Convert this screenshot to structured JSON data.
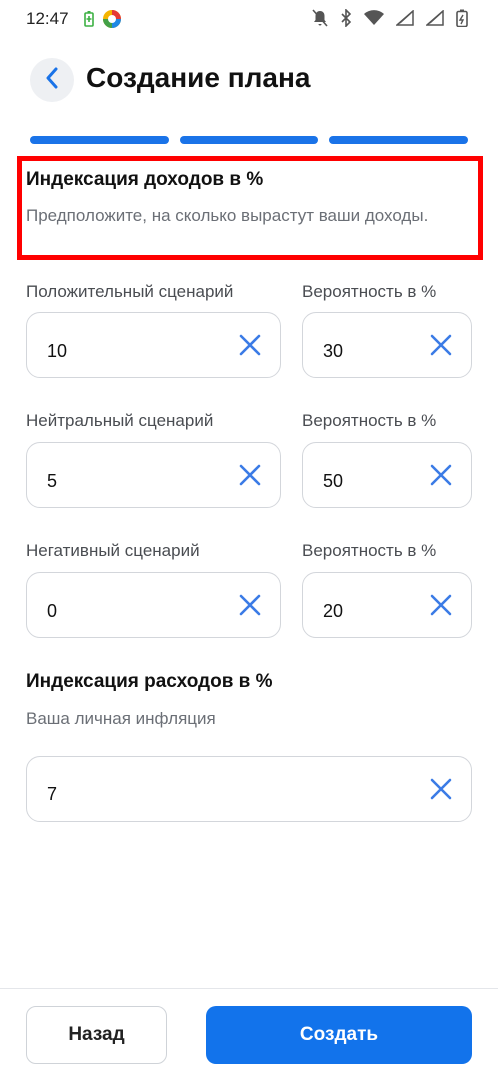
{
  "status_bar": {
    "time": "12:47"
  },
  "header": {
    "title": "Создание плана"
  },
  "progress": {
    "total_steps": 3,
    "completed_steps": 3,
    "accent": "#1a73e8"
  },
  "income_section": {
    "title": "Индексация доходов в %",
    "subtitle": "Предположите, на сколько вырастут ваши доходы."
  },
  "scenarios": [
    {
      "label": "Положительный сценарий",
      "value": "10",
      "prob_label": "Вероятность в %",
      "prob_value": "30"
    },
    {
      "label": "Нейтральный сценарий",
      "value": "5",
      "prob_label": "Вероятность в %",
      "prob_value": "50"
    },
    {
      "label": "Негативный сценарий",
      "value": "0",
      "prob_label": "Вероятность в %",
      "prob_value": "20"
    }
  ],
  "expense_section": {
    "title": "Индексация расходов в %",
    "subtitle": "Ваша личная инфляция",
    "value": "7"
  },
  "footer": {
    "back_label": "Назад",
    "create_label": "Создать"
  },
  "colors": {
    "primary": "#1273eb",
    "highlight": "#ff0000",
    "clear_icon": "#3b7be6"
  }
}
